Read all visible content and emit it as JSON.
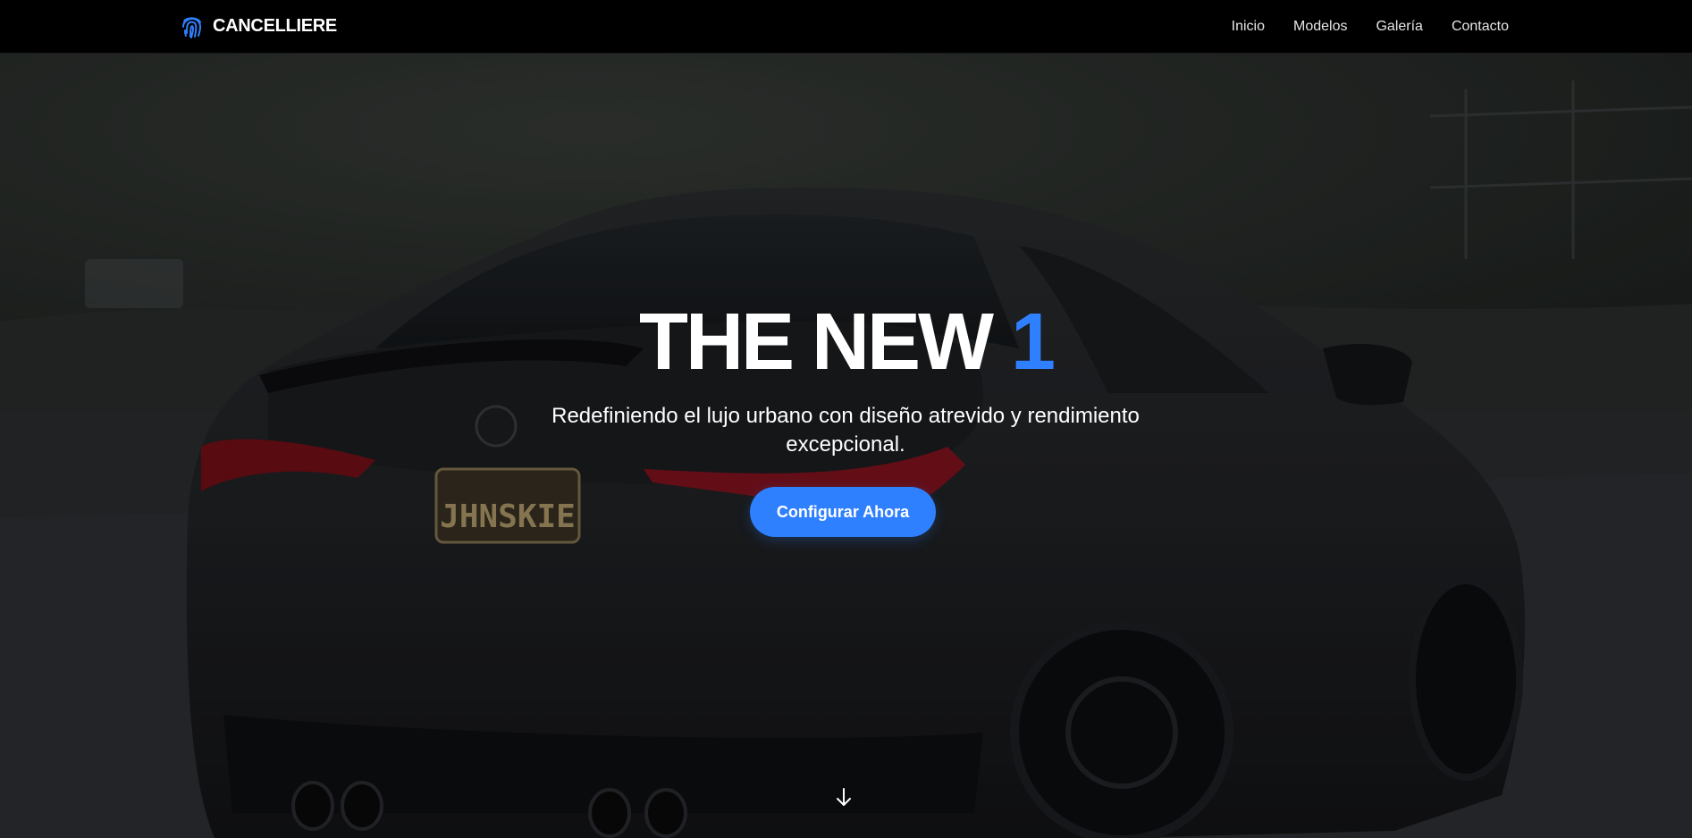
{
  "brand": {
    "name": "CANCELLIERE",
    "icon": "fingerprint-icon",
    "accent_color": "#2f80ff"
  },
  "nav": {
    "items": [
      {
        "label": "Inicio"
      },
      {
        "label": "Modelos"
      },
      {
        "label": "Galería"
      },
      {
        "label": "Contacto"
      }
    ]
  },
  "hero": {
    "title_main": "THE NEW",
    "title_accent": "1",
    "subtitle": "Redefiniendo el lujo urbano con diseño atrevido y rendimiento excepcional.",
    "cta_label": "Configurar Ahora",
    "cta_color": "#2f80ff",
    "scroll_icon": "arrow-down-icon",
    "background_image": "dark-sports-coupe-rear-view",
    "license_plate": "JHNSKIE"
  }
}
